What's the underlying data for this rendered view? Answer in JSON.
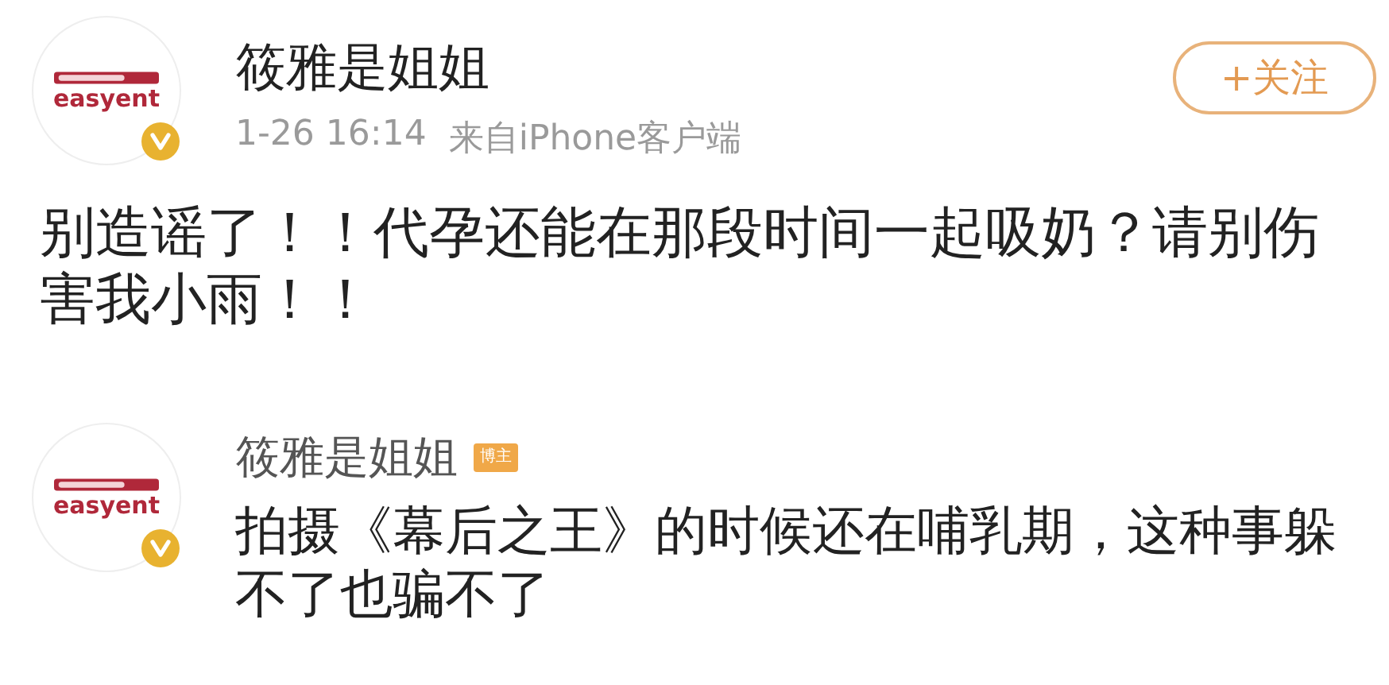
{
  "post": {
    "author": "筱雅是姐姐",
    "avatar_logo": "easyent",
    "time": "1-26 16:14",
    "source": "来自iPhone客户端",
    "follow_button": "+关注",
    "text": "别造谣了！！代孕还能在那段时间一起吸奶？请别伤害我小雨！！"
  },
  "comments": [
    {
      "author": "筱雅是姐姐",
      "avatar_logo": "easyent",
      "badge": "博主",
      "text": "拍摄《幕后之王》的时候还在哺乳期，这种事躲不了也骗不了"
    }
  ]
}
